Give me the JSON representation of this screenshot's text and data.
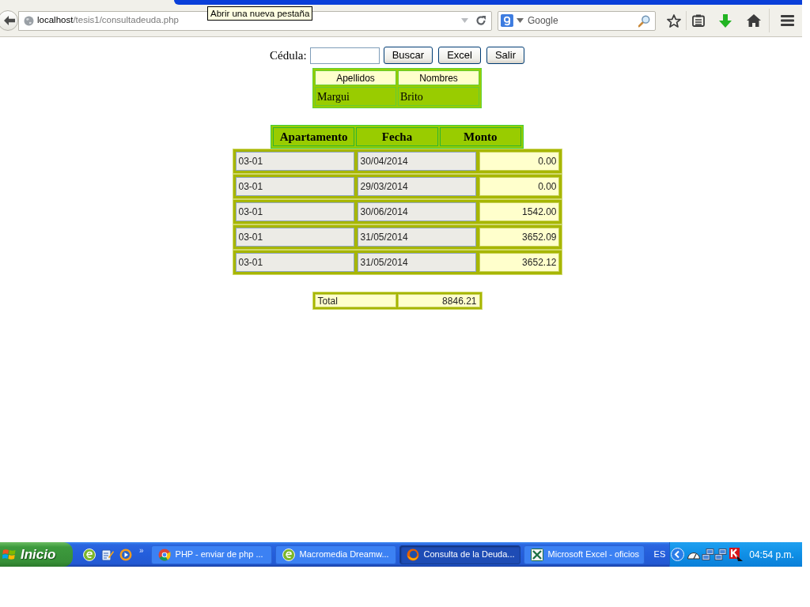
{
  "browser": {
    "tooltip": "Abrir una nueva pestaña",
    "address": {
      "host": "localhost",
      "path": "/tesis1/consultadeuda.php"
    },
    "search": {
      "placeholder": "Google"
    }
  },
  "form": {
    "label": "Cédula:",
    "buttons": [
      "Buscar",
      "Excel",
      "Salir"
    ]
  },
  "person_table": {
    "columns": [
      "Apellidos",
      "Nombres"
    ],
    "rows": [
      [
        "Margui",
        "Brito"
      ]
    ]
  },
  "debt_table": {
    "columns": [
      "Apartamento",
      "Fecha",
      "Monto"
    ],
    "rows": [
      [
        "03-01",
        "30/04/2014",
        "0.00"
      ],
      [
        "03-01",
        "29/03/2014",
        "0.00"
      ],
      [
        "03-01",
        "30/06/2014",
        "1542.00"
      ],
      [
        "03-01",
        "31/05/2014",
        "3652.09"
      ],
      [
        "03-01",
        "31/05/2014",
        "3652.12"
      ]
    ]
  },
  "total": {
    "label": "Total",
    "value": "8846.21"
  },
  "taskbar": {
    "start": "Inicio",
    "quick_launch_more": "»",
    "tasks": [
      {
        "label": "PHP - enviar de php ...",
        "selected": false
      },
      {
        "label": "Macromedia Dreamw...",
        "selected": false
      },
      {
        "label": "Consulta de la Deuda...",
        "selected": true
      },
      {
        "label": "Microsoft Excel - oficios",
        "selected": false
      }
    ],
    "language": "ES",
    "clock": "04:54 p.m."
  }
}
